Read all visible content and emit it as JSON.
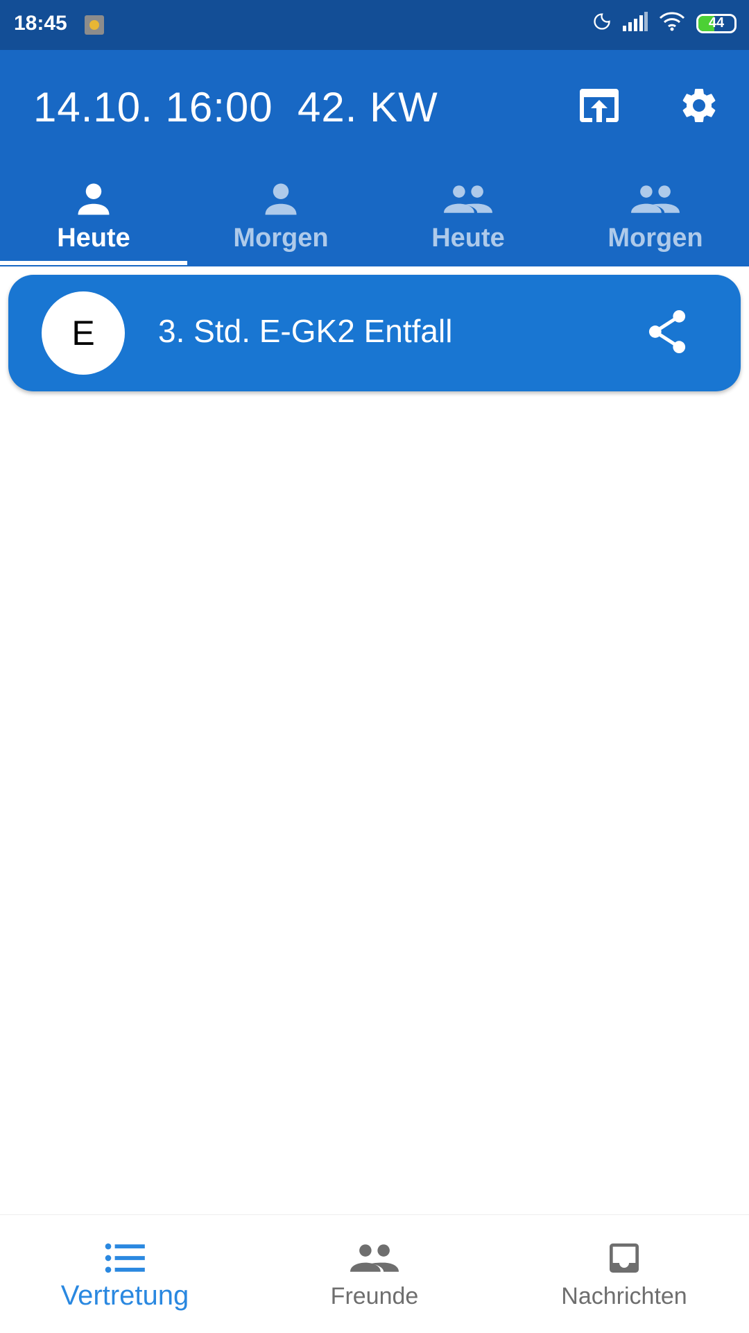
{
  "status_bar": {
    "time": "18:45",
    "battery": "44",
    "icons": [
      "app-notification-icon",
      "moon-icon",
      "signal-icon",
      "wifi-icon",
      "battery-icon"
    ]
  },
  "app_bar": {
    "date_time": "14.10. 16:00",
    "week": "42. KW",
    "actions": [
      "open-in-browser-icon",
      "gear-icon"
    ]
  },
  "tabs": [
    {
      "label": "Heute",
      "icon": "person-icon",
      "active": true
    },
    {
      "label": "Morgen",
      "icon": "person-icon",
      "active": false
    },
    {
      "label": "Heute",
      "icon": "people-icon",
      "active": false
    },
    {
      "label": "Morgen",
      "icon": "people-icon",
      "active": false
    }
  ],
  "items": [
    {
      "avatar_letter": "E",
      "text": "3. Std. E-GK2 Entfall",
      "action_icon": "share-icon"
    }
  ],
  "bottom_nav": [
    {
      "label": "Vertretung",
      "icon": "list-icon",
      "active": true
    },
    {
      "label": "Freunde",
      "icon": "people-icon",
      "active": false
    },
    {
      "label": "Nachrichten",
      "icon": "inbox-icon",
      "active": false
    }
  ],
  "colors": {
    "status_bar": "#134e96",
    "app_bar": "#1868c4",
    "card": "#1976d2",
    "active_nav": "#2a88e0",
    "inactive_nav": "#6e6e6e"
  }
}
